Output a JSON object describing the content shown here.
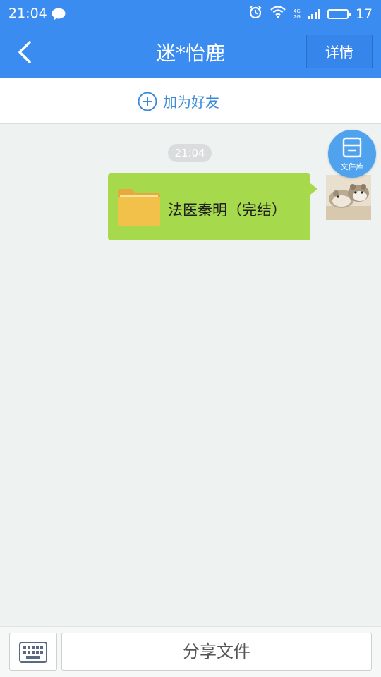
{
  "status_bar": {
    "time": "21:04",
    "net_top": "4G",
    "net_bottom": "2G",
    "battery_level": "17"
  },
  "header": {
    "title": "迷*怡鹿",
    "detail_label": "详情"
  },
  "add_friend": {
    "label": "加为好友"
  },
  "chat": {
    "timestamp": "21:04",
    "message": {
      "file_name": "法医秦明（完结）",
      "icon": "folder-icon"
    }
  },
  "file_library": {
    "label": "文件库"
  },
  "bottom_bar": {
    "share_label": "分享文件",
    "keyboard_icon": "keyboard-icon"
  },
  "colors": {
    "primary": "#3b8cf0",
    "bubble": "#a6d94b",
    "folder": "#f2c14a",
    "background": "#eef2f1"
  }
}
